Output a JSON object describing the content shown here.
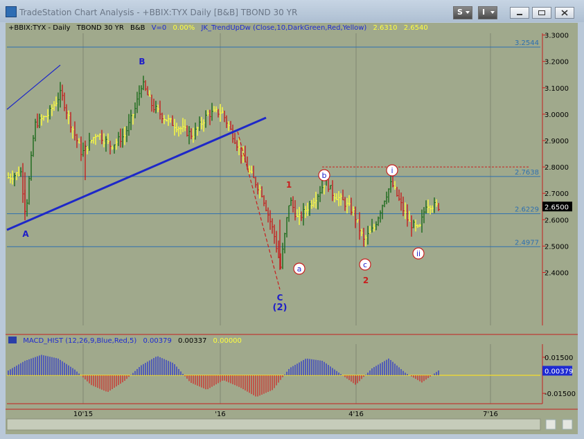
{
  "window": {
    "title": "TradeStation Chart Analysis - +BBIX:TYX Daily [B&B] TBOND 30 YR",
    "s_label": "S",
    "i_label": "I"
  },
  "legend": {
    "symbol": "+BBIX:TYX - Daily",
    "description": "TBOND 30 YR",
    "tag": "B&B",
    "volume": "V=0",
    "pct": "0.00%",
    "indicator": "JK_TrendUpDw (Close,10,DarkGreen,Red,Yellow)",
    "val1": "2.6310",
    "val2": "2.6540"
  },
  "macd_legend": {
    "label": "MACD_HIST (12,26,9,Blue,Red,5)",
    "val1": "0.00379",
    "val2": "0.00337",
    "val3": "0.00000"
  },
  "price_axis": {
    "ticks": [
      "3.3000",
      "3.2000",
      "3.1000",
      "3.0000",
      "2.9000",
      "2.8000",
      "2.7000",
      "2.6000",
      "2.5000",
      "2.4000"
    ],
    "current_price": "2.6500"
  },
  "level_labels": [
    "3.2544",
    "2.7638",
    "2.6229",
    "2.4977"
  ],
  "macd_axis": {
    "ticks": [
      "0.01500",
      "-0.01500"
    ],
    "current_value": "0.00379"
  },
  "date_axis": [
    "10'15",
    "'16",
    "4'16",
    "7'16"
  ],
  "wave_labels": {
    "A": "A",
    "B": "B",
    "C": "C",
    "two_paren": "(2)",
    "one": "1",
    "two": "2",
    "a": "a",
    "b": "b",
    "c": "c",
    "i": "i",
    "ii": "ii"
  },
  "colors": {
    "chart_bg": "#a0a98c",
    "up_bar": "#1a6a1a",
    "down_bar": "#c41e1e",
    "neutral_bar": "#ffff3c",
    "trendline": "#1e28c8",
    "level_line": "#2d6fb0",
    "wave_blue": "#1e1ec8",
    "wave_red": "#c81e1e",
    "macd_pos": "#1e2ad2",
    "macd_neg": "#d21e1e"
  },
  "chart_data": [
    {
      "type": "ohlc",
      "title": "+BBIX:TYX - Daily TBOND 30 YR",
      "x": [
        "10'15",
        "'16",
        "4'16",
        "7'16"
      ],
      "ylim": [
        2.35,
        3.33
      ],
      "horizontal_levels": [
        3.2544,
        2.7638,
        2.6229,
        2.4977
      ],
      "resistance_level": 2.8,
      "last": 2.65,
      "legend": [
        "JK_TrendUpDw (Close,10,DarkGreen,Red,Yellow)"
      ]
    },
    {
      "type": "bar",
      "title": "MACD_HIST (12,26,9,Blue,Red,5)",
      "ylim": [
        -0.02,
        0.02
      ],
      "last": 0.00379,
      "series": [
        {
          "name": "MACD_HIST",
          "values": [
            0.004,
            0.012,
            0.017,
            0.014,
            0.005,
            -0.008,
            -0.014,
            -0.005,
            0.008,
            0.016,
            0.01,
            -0.006,
            -0.012,
            -0.004,
            -0.01,
            -0.018,
            -0.012,
            0.006,
            0.014,
            0.012,
            0.002,
            -0.008,
            0.006,
            0.014,
            0.002,
            -0.006,
            0.004
          ]
        }
      ]
    }
  ]
}
